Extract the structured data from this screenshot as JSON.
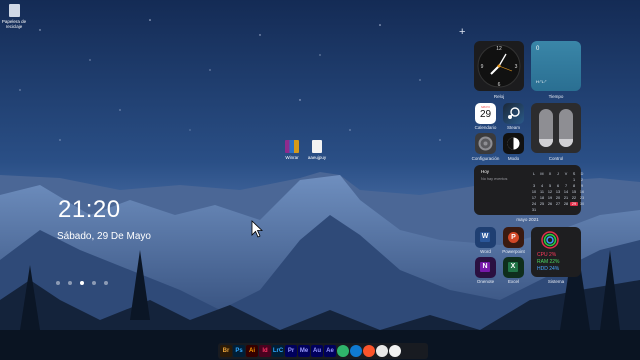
{
  "desktop": {
    "recycle_bin_label": "Papelera de reciclaje",
    "icons": [
      {
        "label": "Winrar"
      },
      {
        "label": "aaeujpuy"
      }
    ]
  },
  "lockscreen": {
    "time": "21:20",
    "date": "Sábado, 29 De Mayo",
    "pages": 5,
    "active_page": 3
  },
  "widgets": {
    "add_symbol": "+",
    "clock": {
      "label": "Reloj"
    },
    "weather": {
      "label": "Tiempo",
      "temp": "0",
      "range": "H:°L:°"
    },
    "calendar_app": {
      "label": "Calendario",
      "month": "MAYO",
      "day": "29"
    },
    "steam": {
      "label": "Steam"
    },
    "settings": {
      "label": "Configuración"
    },
    "mode": {
      "label": "Modo"
    },
    "control": {
      "label": "Control"
    },
    "month_calendar": {
      "today_label": "Hoy",
      "no_events": "No hay eventos",
      "month_label": "mayo 2021",
      "weekdays": [
        "L",
        "M",
        "X",
        "J",
        "V",
        "S",
        "D"
      ],
      "days": [
        "",
        "",
        "",
        "",
        "",
        "1",
        "2",
        "3",
        "4",
        "5",
        "6",
        "7",
        "8",
        "9",
        "10",
        "11",
        "12",
        "13",
        "14",
        "15",
        "16",
        "17",
        "18",
        "19",
        "20",
        "21",
        "22",
        "23",
        "24",
        "25",
        "26",
        "27",
        "28",
        "29",
        "30",
        "31"
      ],
      "highlight": "29"
    },
    "apps": [
      {
        "label": "Word",
        "letter": "W",
        "color": "#2b579a"
      },
      {
        "label": "Powerpoint",
        "letter": "P",
        "color": "#d24726"
      },
      {
        "label": "Onenote",
        "letter": "N",
        "color": "#7719aa"
      },
      {
        "label": "Excel",
        "letter": "X",
        "color": "#217346"
      }
    ],
    "system": {
      "label": "Sistema",
      "cpu": "CPU 2%",
      "ram": "RAM 22%",
      "hdd": "HDD 24%"
    }
  },
  "taskbar": [
    {
      "name": "bridge",
      "text": "Br",
      "bg": "#2a1a08",
      "fg": "#e8a33a"
    },
    {
      "name": "photoshop",
      "text": "Ps",
      "bg": "#001e36",
      "fg": "#31a8ff"
    },
    {
      "name": "illustrator",
      "text": "Ai",
      "bg": "#330000",
      "fg": "#ff9a00"
    },
    {
      "name": "indesign",
      "text": "Id",
      "bg": "#49021f",
      "fg": "#ff3366"
    },
    {
      "name": "lightroom",
      "text": "LrC",
      "bg": "#001e36",
      "fg": "#31a8ff"
    },
    {
      "name": "premiere",
      "text": "Pr",
      "bg": "#00005b",
      "fg": "#9999ff"
    },
    {
      "name": "media-encoder",
      "text": "Me",
      "bg": "#00005b",
      "fg": "#9999ff"
    },
    {
      "name": "audition",
      "text": "Au",
      "bg": "#00005b",
      "fg": "#9999ff"
    },
    {
      "name": "after-effects",
      "text": "Ae",
      "bg": "#00005b",
      "fg": "#9999ff"
    },
    {
      "name": "camtasia",
      "text": "",
      "bg": "#2fb46b",
      "fg": "#fff"
    },
    {
      "name": "edge",
      "text": "",
      "bg": "#0f7ad1",
      "fg": "#fff"
    },
    {
      "name": "brave",
      "text": "",
      "bg": "#fb542b",
      "fg": "#fff"
    },
    {
      "name": "chrome",
      "text": "",
      "bg": "#e8e8e8",
      "fg": "#fff"
    },
    {
      "name": "calendar-tb",
      "text": "",
      "bg": "#f2f2f2",
      "fg": "#c33"
    }
  ]
}
